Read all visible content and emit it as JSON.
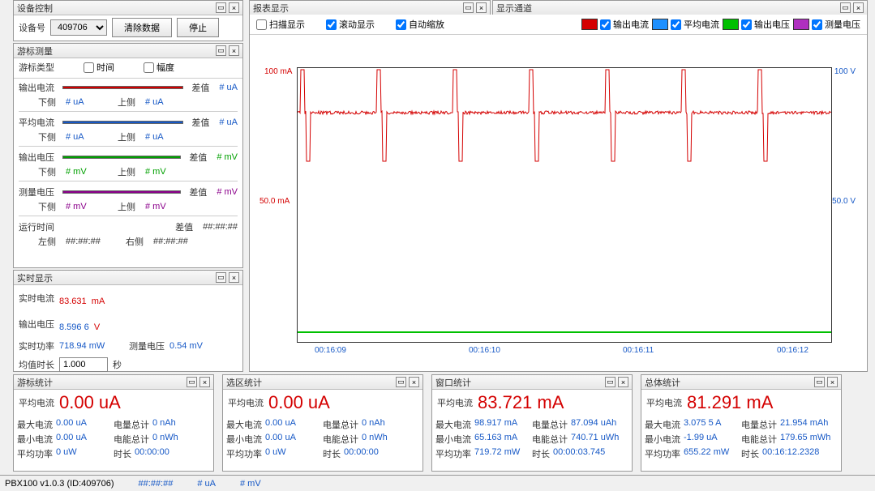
{
  "device_ctrl": {
    "title": "设备控制",
    "dev_label": "设备号",
    "dev_id": "409706",
    "btn_clear": "清除数据",
    "btn_stop": "停止"
  },
  "cursor": {
    "title": "游标测量",
    "type_label": "游标类型",
    "chk_time": "时间",
    "chk_amp": "幅度",
    "ch": [
      {
        "name": "输出电流",
        "bar": "#d40000",
        "diff": "差值",
        "diff_v": "# uA",
        "lo": "下侧",
        "lo_v": "# uA",
        "hi": "上侧",
        "hi_v": "# uA",
        "ucls": "blue"
      },
      {
        "name": "平均电流",
        "bar": "#1658c6",
        "diff": "差值",
        "diff_v": "# uA",
        "lo": "下侧",
        "lo_v": "# uA",
        "hi": "上侧",
        "hi_v": "# uA",
        "ucls": "blue"
      },
      {
        "name": "输出电压",
        "bar": "#00a000",
        "diff": "差值",
        "diff_v": "# mV",
        "lo": "下侧",
        "lo_v": "# mV",
        "hi": "上侧",
        "hi_v": "# mV",
        "ucls": "green"
      },
      {
        "name": "测量电压",
        "bar": "#8b008b",
        "diff": "差值",
        "diff_v": "# mV",
        "lo": "下侧",
        "lo_v": "# mV",
        "hi": "上侧",
        "hi_v": "# mV",
        "ucls": "purple"
      }
    ],
    "runtime": "运行时间",
    "rt_diff": "差值",
    "rt_diff_v": "##:##:##",
    "rt_left": "左侧",
    "rt_left_v": "##:##:##",
    "rt_right": "右侧",
    "rt_right_v": "##:##:##"
  },
  "realtime": {
    "title": "实时显示",
    "i_label": "实时电流",
    "i_val": "83.631",
    "i_unit": "mA",
    "v_label": "输出电压",
    "v_val": "8.596 6",
    "v_unit": "V",
    "p_label": "实时功率",
    "p_val": "718.94 mW",
    "mv_label": "测量电压",
    "mv_val": "0.54 mV",
    "avg_label": "均值时长",
    "avg_val": "1.000",
    "avg_unit": "秒"
  },
  "chart": {
    "title": "报表显示",
    "chk_scan": "扫描显示",
    "chk_scroll": "滚动显示",
    "chk_auto": "自动缩放",
    "leg": [
      {
        "c": "#d40000",
        "t": "输出电流"
      },
      {
        "c": "#1e90ff",
        "t": "平均电流"
      },
      {
        "c": "#00c000",
        "t": "输出电压"
      },
      {
        "c": "#b030c0",
        "t": "测量电压"
      }
    ],
    "y1_top": "100 mA",
    "y1_mid": "50.0 mA",
    "y2_top": "100 V",
    "y2_mid": "50.0 V",
    "x": [
      "00:16:09",
      "00:16:10",
      "00:16:11",
      "00:16:12"
    ]
  },
  "channels": {
    "title": "显示通道"
  },
  "chart_data": {
    "type": "line",
    "title": "",
    "x_ticks": [
      "00:16:09",
      "00:16:10",
      "00:16:11",
      "00:16:12"
    ],
    "y_left": {
      "label": "mA",
      "range": [
        0,
        100
      ],
      "ticks": [
        50,
        100
      ]
    },
    "y_right": {
      "label": "V",
      "range": [
        0,
        100
      ],
      "ticks": [
        50,
        100
      ]
    },
    "series": [
      {
        "name": "输出电流",
        "color": "#d40000",
        "axis": "left",
        "baseline": 83.7,
        "spikes_to": 100,
        "spike_count": 7
      },
      {
        "name": "平均电流",
        "color": "#1e90ff",
        "axis": "left",
        "baseline": 83.7
      },
      {
        "name": "输出电压",
        "color": "#00c000",
        "axis": "right",
        "baseline": 8.6
      },
      {
        "name": "测量电压",
        "color": "#b030c0",
        "axis": "right",
        "baseline": 0.5
      }
    ]
  },
  "stats": [
    {
      "title": "游标统计",
      "avg_i": "平均电流",
      "avg_i_v": "0.00",
      "avg_i_u": "uA",
      "rows": [
        [
          "最大电流",
          "0.00 uA",
          "电量总计",
          "0 nAh"
        ],
        [
          "最小电流",
          "0.00 uA",
          "电能总计",
          "0 nWh"
        ],
        [
          "平均功率",
          "0 uW",
          "时长",
          "00:00:00"
        ]
      ]
    },
    {
      "title": "选区统计",
      "avg_i": "平均电流",
      "avg_i_v": "0.00",
      "avg_i_u": "uA",
      "rows": [
        [
          "最大电流",
          "0.00 uA",
          "电量总计",
          "0 nAh"
        ],
        [
          "最小电流",
          "0.00 uA",
          "电能总计",
          "0 nWh"
        ],
        [
          "平均功率",
          "0 uW",
          "时长",
          "00:00:00"
        ]
      ]
    },
    {
      "title": "窗口统计",
      "avg_i": "平均电流",
      "avg_i_v": "83.721",
      "avg_i_u": "mA",
      "rows": [
        [
          "最大电流",
          "98.917 mA",
          "电量总计",
          "87.094 uAh"
        ],
        [
          "最小电流",
          "65.163 mA",
          "电能总计",
          "740.71 uWh"
        ],
        [
          "平均功率",
          "719.72 mW",
          "时长",
          "00:00:03.745"
        ]
      ]
    },
    {
      "title": "总体统计",
      "avg_i": "平均电流",
      "avg_i_v": "81.291",
      "avg_i_u": "mA",
      "rows": [
        [
          "最大电流",
          "3.075 5 A",
          "电量总计",
          "21.954 mAh"
        ],
        [
          "最小电流",
          "-1.99 uA",
          "电能总计",
          "179.65 mWh"
        ],
        [
          "平均功率",
          "655.22 mW",
          "时长",
          "00:16:12.2328"
        ]
      ]
    }
  ],
  "status": {
    "ver": "PBX100 v1.0.3 (ID:409706)",
    "t": "##:##:##",
    "ua": "# uA",
    "mv": "# mV"
  }
}
